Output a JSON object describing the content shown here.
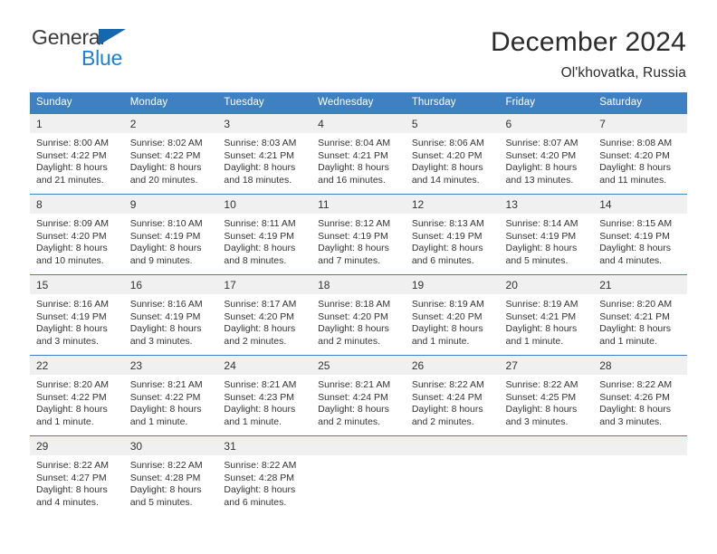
{
  "brand": {
    "name_top": "General",
    "name_bottom": "Blue",
    "accent_color": "#1f7fd0",
    "triangle_color": "#1567b0"
  },
  "header": {
    "title": "December 2024",
    "subtitle": "Ol'khovatka, Russia"
  },
  "calendar": {
    "header_bg": "#3f80c2",
    "daynum_bg": "#f0f0f0",
    "weekdays": [
      "Sunday",
      "Monday",
      "Tuesday",
      "Wednesday",
      "Thursday",
      "Friday",
      "Saturday"
    ],
    "weeks": [
      [
        {
          "day": "1",
          "sunrise": "Sunrise: 8:00 AM",
          "sunset": "Sunset: 4:22 PM",
          "daylight_1": "Daylight: 8 hours",
          "daylight_2": "and 21 minutes."
        },
        {
          "day": "2",
          "sunrise": "Sunrise: 8:02 AM",
          "sunset": "Sunset: 4:22 PM",
          "daylight_1": "Daylight: 8 hours",
          "daylight_2": "and 20 minutes."
        },
        {
          "day": "3",
          "sunrise": "Sunrise: 8:03 AM",
          "sunset": "Sunset: 4:21 PM",
          "daylight_1": "Daylight: 8 hours",
          "daylight_2": "and 18 minutes."
        },
        {
          "day": "4",
          "sunrise": "Sunrise: 8:04 AM",
          "sunset": "Sunset: 4:21 PM",
          "daylight_1": "Daylight: 8 hours",
          "daylight_2": "and 16 minutes."
        },
        {
          "day": "5",
          "sunrise": "Sunrise: 8:06 AM",
          "sunset": "Sunset: 4:20 PM",
          "daylight_1": "Daylight: 8 hours",
          "daylight_2": "and 14 minutes."
        },
        {
          "day": "6",
          "sunrise": "Sunrise: 8:07 AM",
          "sunset": "Sunset: 4:20 PM",
          "daylight_1": "Daylight: 8 hours",
          "daylight_2": "and 13 minutes."
        },
        {
          "day": "7",
          "sunrise": "Sunrise: 8:08 AM",
          "sunset": "Sunset: 4:20 PM",
          "daylight_1": "Daylight: 8 hours",
          "daylight_2": "and 11 minutes."
        }
      ],
      [
        {
          "day": "8",
          "sunrise": "Sunrise: 8:09 AM",
          "sunset": "Sunset: 4:20 PM",
          "daylight_1": "Daylight: 8 hours",
          "daylight_2": "and 10 minutes."
        },
        {
          "day": "9",
          "sunrise": "Sunrise: 8:10 AM",
          "sunset": "Sunset: 4:19 PM",
          "daylight_1": "Daylight: 8 hours",
          "daylight_2": "and 9 minutes."
        },
        {
          "day": "10",
          "sunrise": "Sunrise: 8:11 AM",
          "sunset": "Sunset: 4:19 PM",
          "daylight_1": "Daylight: 8 hours",
          "daylight_2": "and 8 minutes."
        },
        {
          "day": "11",
          "sunrise": "Sunrise: 8:12 AM",
          "sunset": "Sunset: 4:19 PM",
          "daylight_1": "Daylight: 8 hours",
          "daylight_2": "and 7 minutes."
        },
        {
          "day": "12",
          "sunrise": "Sunrise: 8:13 AM",
          "sunset": "Sunset: 4:19 PM",
          "daylight_1": "Daylight: 8 hours",
          "daylight_2": "and 6 minutes."
        },
        {
          "day": "13",
          "sunrise": "Sunrise: 8:14 AM",
          "sunset": "Sunset: 4:19 PM",
          "daylight_1": "Daylight: 8 hours",
          "daylight_2": "and 5 minutes."
        },
        {
          "day": "14",
          "sunrise": "Sunrise: 8:15 AM",
          "sunset": "Sunset: 4:19 PM",
          "daylight_1": "Daylight: 8 hours",
          "daylight_2": "and 4 minutes."
        }
      ],
      [
        {
          "day": "15",
          "sunrise": "Sunrise: 8:16 AM",
          "sunset": "Sunset: 4:19 PM",
          "daylight_1": "Daylight: 8 hours",
          "daylight_2": "and 3 minutes."
        },
        {
          "day": "16",
          "sunrise": "Sunrise: 8:16 AM",
          "sunset": "Sunset: 4:19 PM",
          "daylight_1": "Daylight: 8 hours",
          "daylight_2": "and 3 minutes."
        },
        {
          "day": "17",
          "sunrise": "Sunrise: 8:17 AM",
          "sunset": "Sunset: 4:20 PM",
          "daylight_1": "Daylight: 8 hours",
          "daylight_2": "and 2 minutes."
        },
        {
          "day": "18",
          "sunrise": "Sunrise: 8:18 AM",
          "sunset": "Sunset: 4:20 PM",
          "daylight_1": "Daylight: 8 hours",
          "daylight_2": "and 2 minutes."
        },
        {
          "day": "19",
          "sunrise": "Sunrise: 8:19 AM",
          "sunset": "Sunset: 4:20 PM",
          "daylight_1": "Daylight: 8 hours",
          "daylight_2": "and 1 minute."
        },
        {
          "day": "20",
          "sunrise": "Sunrise: 8:19 AM",
          "sunset": "Sunset: 4:21 PM",
          "daylight_1": "Daylight: 8 hours",
          "daylight_2": "and 1 minute."
        },
        {
          "day": "21",
          "sunrise": "Sunrise: 8:20 AM",
          "sunset": "Sunset: 4:21 PM",
          "daylight_1": "Daylight: 8 hours",
          "daylight_2": "and 1 minute."
        }
      ],
      [
        {
          "day": "22",
          "sunrise": "Sunrise: 8:20 AM",
          "sunset": "Sunset: 4:22 PM",
          "daylight_1": "Daylight: 8 hours",
          "daylight_2": "and 1 minute."
        },
        {
          "day": "23",
          "sunrise": "Sunrise: 8:21 AM",
          "sunset": "Sunset: 4:22 PM",
          "daylight_1": "Daylight: 8 hours",
          "daylight_2": "and 1 minute."
        },
        {
          "day": "24",
          "sunrise": "Sunrise: 8:21 AM",
          "sunset": "Sunset: 4:23 PM",
          "daylight_1": "Daylight: 8 hours",
          "daylight_2": "and 1 minute."
        },
        {
          "day": "25",
          "sunrise": "Sunrise: 8:21 AM",
          "sunset": "Sunset: 4:24 PM",
          "daylight_1": "Daylight: 8 hours",
          "daylight_2": "and 2 minutes."
        },
        {
          "day": "26",
          "sunrise": "Sunrise: 8:22 AM",
          "sunset": "Sunset: 4:24 PM",
          "daylight_1": "Daylight: 8 hours",
          "daylight_2": "and 2 minutes."
        },
        {
          "day": "27",
          "sunrise": "Sunrise: 8:22 AM",
          "sunset": "Sunset: 4:25 PM",
          "daylight_1": "Daylight: 8 hours",
          "daylight_2": "and 3 minutes."
        },
        {
          "day": "28",
          "sunrise": "Sunrise: 8:22 AM",
          "sunset": "Sunset: 4:26 PM",
          "daylight_1": "Daylight: 8 hours",
          "daylight_2": "and 3 minutes."
        }
      ],
      [
        {
          "day": "29",
          "sunrise": "Sunrise: 8:22 AM",
          "sunset": "Sunset: 4:27 PM",
          "daylight_1": "Daylight: 8 hours",
          "daylight_2": "and 4 minutes."
        },
        {
          "day": "30",
          "sunrise": "Sunrise: 8:22 AM",
          "sunset": "Sunset: 4:28 PM",
          "daylight_1": "Daylight: 8 hours",
          "daylight_2": "and 5 minutes."
        },
        {
          "day": "31",
          "sunrise": "Sunrise: 8:22 AM",
          "sunset": "Sunset: 4:28 PM",
          "daylight_1": "Daylight: 8 hours",
          "daylight_2": "and 6 minutes."
        },
        {
          "day": "",
          "sunrise": "",
          "sunset": "",
          "daylight_1": "",
          "daylight_2": ""
        },
        {
          "day": "",
          "sunrise": "",
          "sunset": "",
          "daylight_1": "",
          "daylight_2": ""
        },
        {
          "day": "",
          "sunrise": "",
          "sunset": "",
          "daylight_1": "",
          "daylight_2": ""
        },
        {
          "day": "",
          "sunrise": "",
          "sunset": "",
          "daylight_1": "",
          "daylight_2": ""
        }
      ]
    ]
  }
}
